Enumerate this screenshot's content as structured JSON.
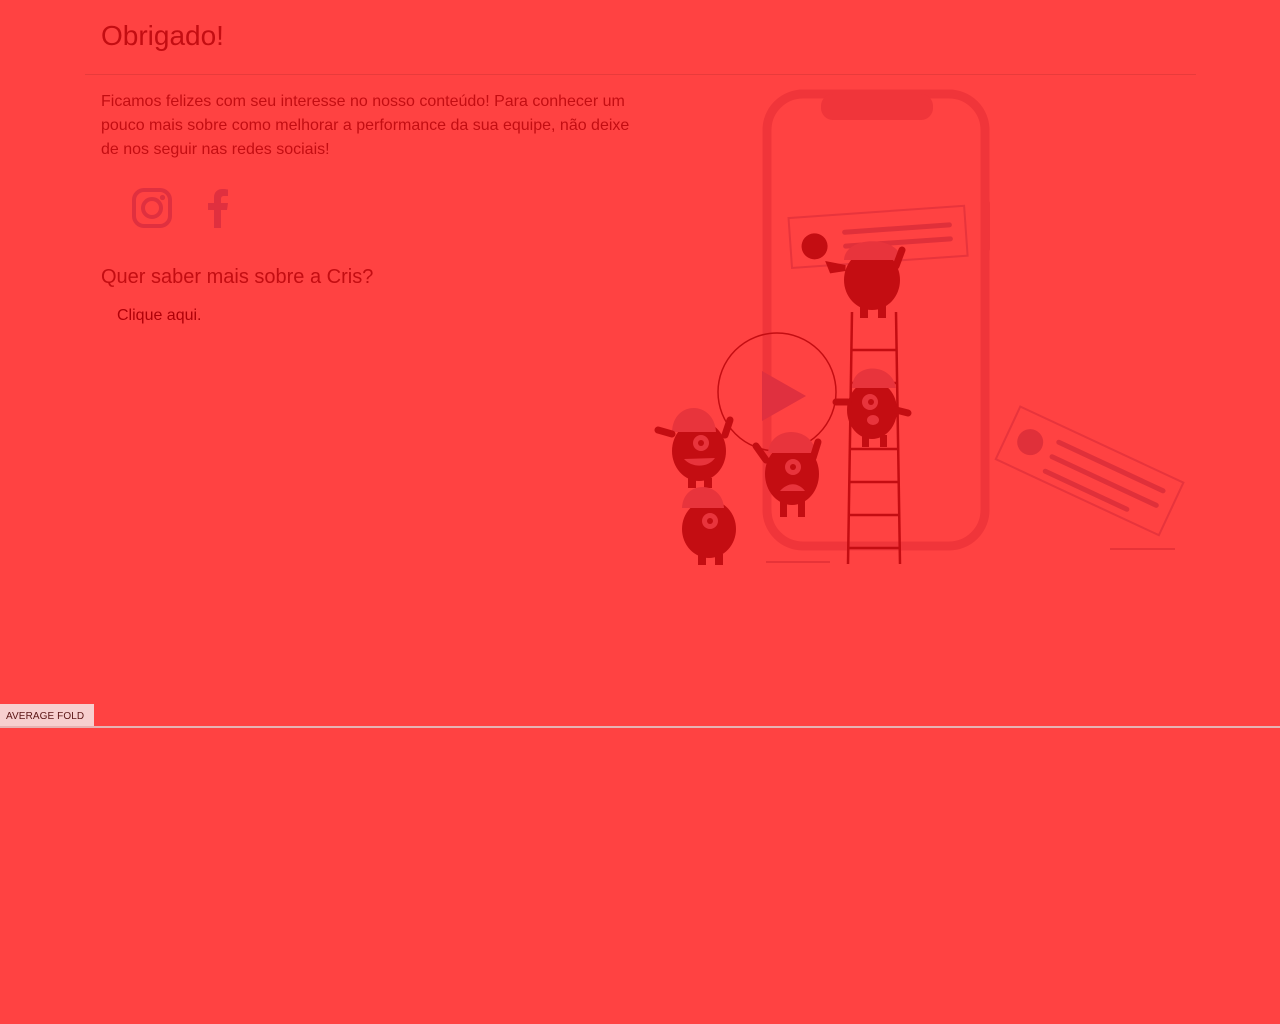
{
  "header": {
    "title": "Obrigado!"
  },
  "content": {
    "intro": "Ficamos felizes com seu interesse no nosso conteúdo! Para conhecer um pouco mais sobre como melhorar a performance da sua equipe, não deixe de nos seguir nas redes sociais!",
    "social": [
      {
        "icon": "instagram-icon"
      },
      {
        "icon": "facebook-icon"
      }
    ],
    "subtitle": "Quer saber mais sobre a Cris?",
    "link_label": "Clique aqui."
  },
  "fold": {
    "label": "AVERAGE FOLD"
  },
  "colors": {
    "background": "#ff4242",
    "text": "#c40d12",
    "icon": "#e0303f",
    "fold_label_bg": "#f7cfcf"
  }
}
